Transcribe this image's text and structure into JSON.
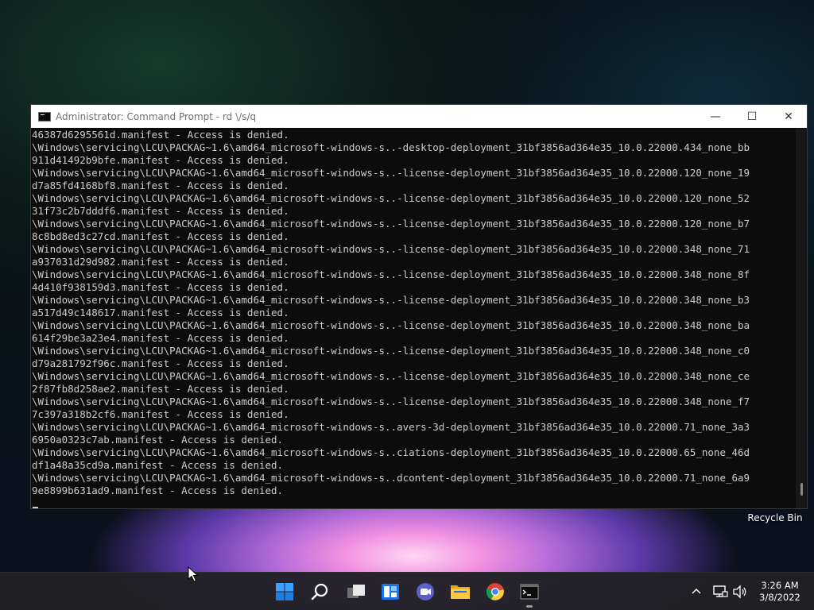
{
  "window": {
    "title": "Administrator: Command Prompt - rd \\/s/q",
    "minimize_glyph": "—",
    "maximize_glyph": "☐",
    "close_glyph": "✕"
  },
  "console": {
    "lines": [
      "46387d6295561d.manifest - Access is denied.",
      "\\Windows\\servicing\\LCU\\PACKAG~1.6\\amd64_microsoft-windows-s..-desktop-deployment_31bf3856ad364e35_10.0.22000.434_none_bb",
      "911d41492b9bfe.manifest - Access is denied.",
      "\\Windows\\servicing\\LCU\\PACKAG~1.6\\amd64_microsoft-windows-s..-license-deployment_31bf3856ad364e35_10.0.22000.120_none_19",
      "d7a85fd4168bf8.manifest - Access is denied.",
      "\\Windows\\servicing\\LCU\\PACKAG~1.6\\amd64_microsoft-windows-s..-license-deployment_31bf3856ad364e35_10.0.22000.120_none_52",
      "31f73c2b7dddf6.manifest - Access is denied.",
      "\\Windows\\servicing\\LCU\\PACKAG~1.6\\amd64_microsoft-windows-s..-license-deployment_31bf3856ad364e35_10.0.22000.120_none_b7",
      "8c8bd8ed3c27cd.manifest - Access is denied.",
      "\\Windows\\servicing\\LCU\\PACKAG~1.6\\amd64_microsoft-windows-s..-license-deployment_31bf3856ad364e35_10.0.22000.348_none_71",
      "a937031d29d982.manifest - Access is denied.",
      "\\Windows\\servicing\\LCU\\PACKAG~1.6\\amd64_microsoft-windows-s..-license-deployment_31bf3856ad364e35_10.0.22000.348_none_8f",
      "4d410f938159d3.manifest - Access is denied.",
      "\\Windows\\servicing\\LCU\\PACKAG~1.6\\amd64_microsoft-windows-s..-license-deployment_31bf3856ad364e35_10.0.22000.348_none_b3",
      "a517d49c148617.manifest - Access is denied.",
      "\\Windows\\servicing\\LCU\\PACKAG~1.6\\amd64_microsoft-windows-s..-license-deployment_31bf3856ad364e35_10.0.22000.348_none_ba",
      "614f29be3a23e4.manifest - Access is denied.",
      "\\Windows\\servicing\\LCU\\PACKAG~1.6\\amd64_microsoft-windows-s..-license-deployment_31bf3856ad364e35_10.0.22000.348_none_c0",
      "d79a281792f96c.manifest - Access is denied.",
      "\\Windows\\servicing\\LCU\\PACKAG~1.6\\amd64_microsoft-windows-s..-license-deployment_31bf3856ad364e35_10.0.22000.348_none_ce",
      "2f87fb8d258ae2.manifest - Access is denied.",
      "\\Windows\\servicing\\LCU\\PACKAG~1.6\\amd64_microsoft-windows-s..-license-deployment_31bf3856ad364e35_10.0.22000.348_none_f7",
      "7c397a318b2cf6.manifest - Access is denied.",
      "\\Windows\\servicing\\LCU\\PACKAG~1.6\\amd64_microsoft-windows-s..avers-3d-deployment_31bf3856ad364e35_10.0.22000.71_none_3a3",
      "6950a0323c7ab.manifest - Access is denied.",
      "\\Windows\\servicing\\LCU\\PACKAG~1.6\\amd64_microsoft-windows-s..ciations-deployment_31bf3856ad364e35_10.0.22000.65_none_46d",
      "df1a48a35cd9a.manifest - Access is denied.",
      "\\Windows\\servicing\\LCU\\PACKAG~1.6\\amd64_microsoft-windows-s..dcontent-deployment_31bf3856ad364e35_10.0.22000.71_none_6a9",
      "9e8899b631ad9.manifest - Access is denied."
    ]
  },
  "desktop": {
    "recycle_bin_label": "Recycle Bin"
  },
  "taskbar": {
    "icons": [
      "windows-start-icon",
      "search-icon",
      "task-view-icon",
      "widgets-icon",
      "chat-icon",
      "file-explorer-icon",
      "chrome-icon",
      "command-prompt-icon"
    ],
    "clock_time": "3:26 AM",
    "clock_date": "3/8/2022",
    "accent_color": "#1e90ff"
  }
}
